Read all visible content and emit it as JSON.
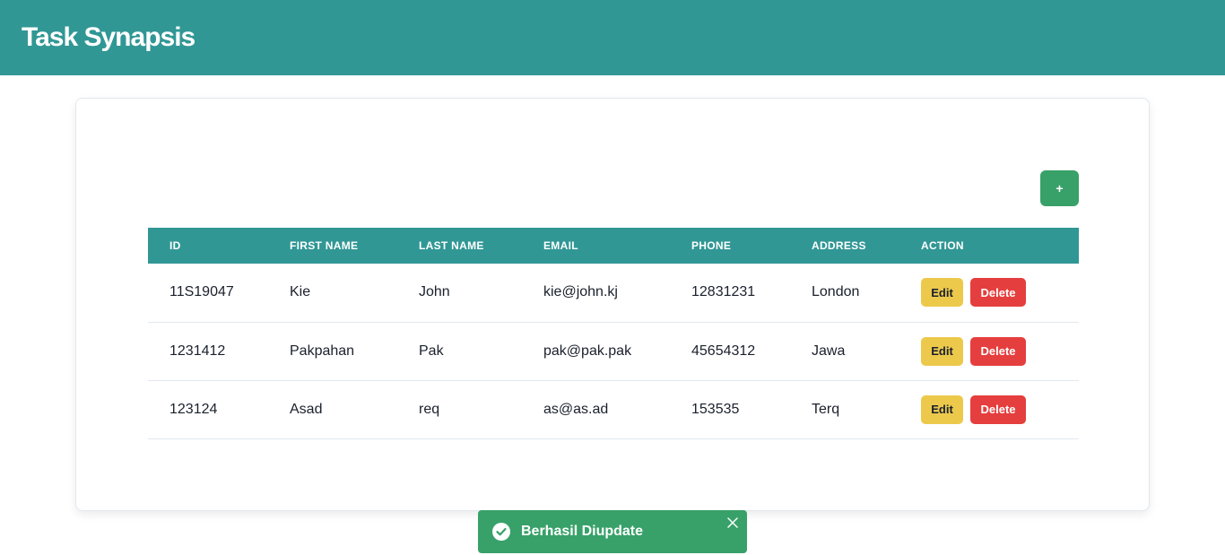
{
  "app": {
    "title": "Task Synapsis"
  },
  "toolbar": {
    "add_label": "+"
  },
  "table": {
    "columns": [
      "ID",
      "FIRST NAME",
      "LAST NAME",
      "EMAIL",
      "PHONE",
      "ADDRESS",
      "ACTION"
    ],
    "rows": [
      {
        "id": "11S19047",
        "first_name": "Kie",
        "last_name": "John",
        "email": "kie@john.kj",
        "phone": "12831231",
        "address": "London"
      },
      {
        "id": "1231412",
        "first_name": "Pakpahan",
        "last_name": "Pak",
        "email": "pak@pak.pak",
        "phone": "45654312",
        "address": "Jawa"
      },
      {
        "id": "123124",
        "first_name": "Asad",
        "last_name": "req",
        "email": "as@as.ad",
        "phone": "153535",
        "address": "Terq"
      }
    ],
    "edit_label": "Edit",
    "delete_label": "Delete"
  },
  "toast": {
    "message": "Berhasil Diupdate",
    "icon": "check-circle-icon"
  },
  "colors": {
    "primary": "#319795",
    "success": "#38a169",
    "warning": "#ecc94b",
    "danger": "#e53e3e"
  }
}
